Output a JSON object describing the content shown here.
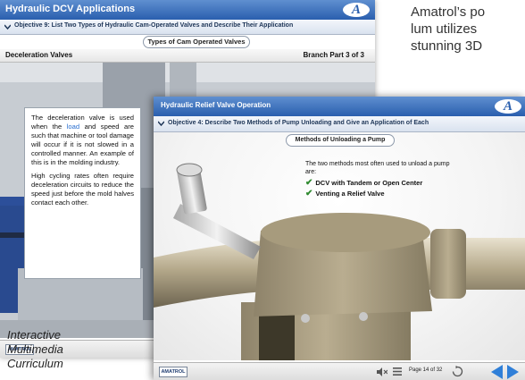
{
  "back_window": {
    "title": "Hydraulic DCV Applications",
    "objective": "Objective 9: List Two Types of Hydraulic Cam-Operated Valves and Describe Their Application",
    "topic_button": "Types of Cam Operated Valves",
    "section_title": "Deceleration Valves",
    "branch_label": "Branch Part 3 of 3",
    "paragraph1_before": "The deceleration valve is used when the ",
    "paragraph1_link": "load",
    "paragraph1_after": " and speed are such that machine or tool damage will occur if it is not slowed in a controlled manner. An example of this is in the molding industry.",
    "paragraph2": "High cycling rates often require deceleration circuits to reduce the speed just before the mold halves contact each other.",
    "footer_logo": "AMATROL"
  },
  "front_window": {
    "title": "Hydraulic Relief Valve Operation",
    "objective": "Objective 4: Describe Two Methods of Pump Unloading and Give an Application of Each",
    "topic_button": "Methods of Unloading a Pump",
    "intro": "The two methods most often used to unload a pump are:",
    "items": [
      "DCV with Tandem or Open Center",
      "Venting a Relief Valve"
    ],
    "page_info": "Page 14 of 32",
    "footer_logo": "AMATROL"
  },
  "logo_letter": "A",
  "promo_text": "Amatrol’s po lum utilizes stunning 3D",
  "promo_lines": [
    "Amatrol’s po",
    "lum utilizes",
    "stunning 3D"
  ],
  "caption_lines": [
    "Interactive",
    "Multimedia",
    "Curriculum"
  ],
  "colors": {
    "title_blue": "#2a5fae",
    "link_blue": "#2a6fd0",
    "check_green": "#2f8a2f",
    "nav_blue": "#2f7fd8"
  }
}
